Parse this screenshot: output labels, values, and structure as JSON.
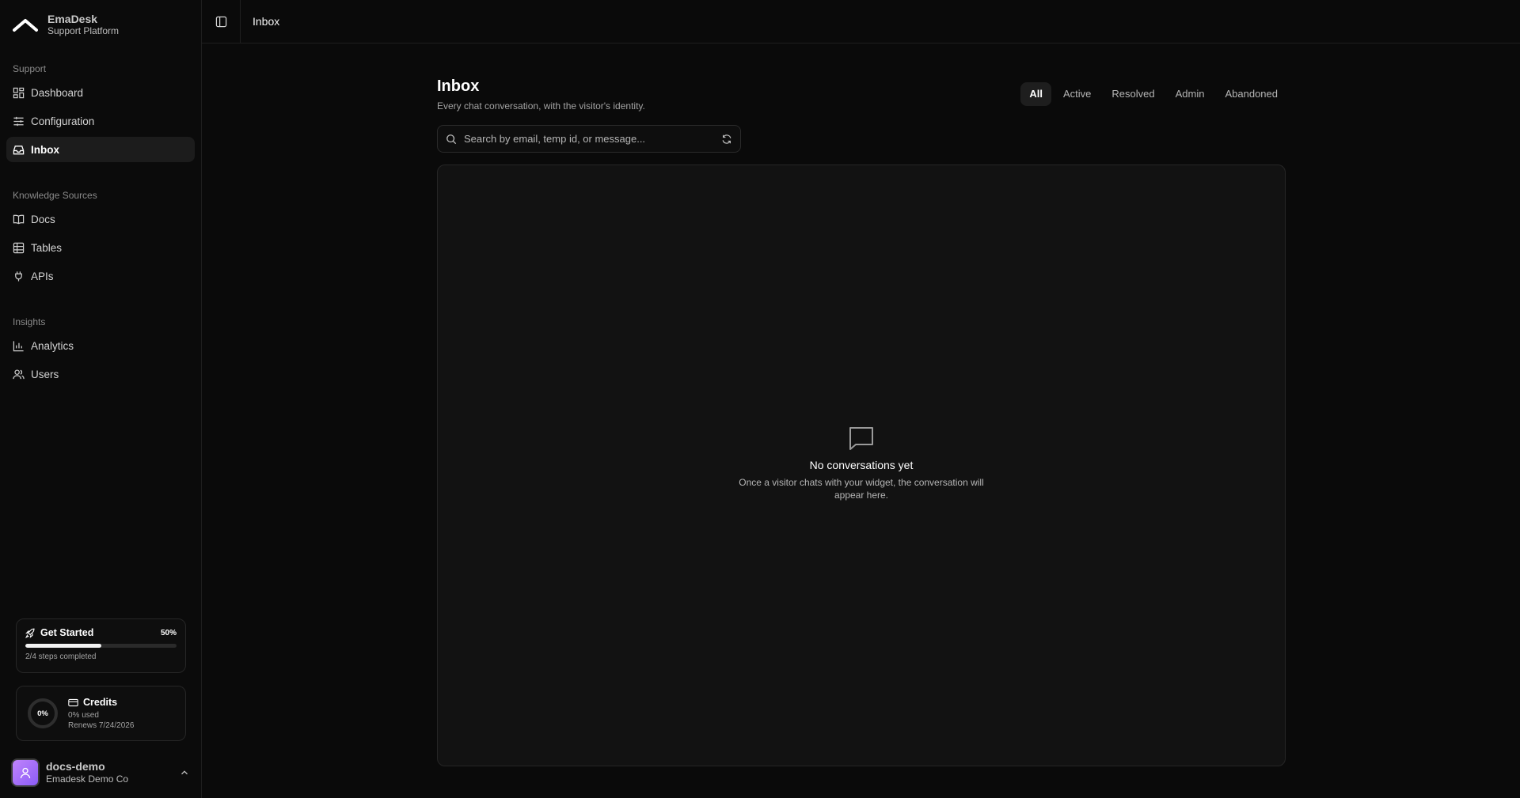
{
  "brand": {
    "name": "EmaDesk",
    "subtitle": "Support Platform"
  },
  "sidebar": {
    "groups": [
      {
        "label": "Support",
        "items": [
          {
            "label": "Dashboard",
            "icon": "dashboard-icon"
          },
          {
            "label": "Configuration",
            "icon": "sliders-icon"
          },
          {
            "label": "Inbox",
            "icon": "inbox-icon",
            "active": true
          }
        ]
      },
      {
        "label": "Knowledge Sources",
        "items": [
          {
            "label": "Docs",
            "icon": "book-icon"
          },
          {
            "label": "Tables",
            "icon": "table-icon"
          },
          {
            "label": "APIs",
            "icon": "plug-icon"
          }
        ]
      },
      {
        "label": "Insights",
        "items": [
          {
            "label": "Analytics",
            "icon": "bar-chart-icon"
          },
          {
            "label": "Users",
            "icon": "users-icon"
          }
        ]
      }
    ]
  },
  "get_started": {
    "title": "Get Started",
    "percent_label": "50%",
    "progress": 0.5,
    "steps": "2/4 steps completed"
  },
  "credits": {
    "title": "Credits",
    "ring_label": "0%",
    "used": "0% used",
    "renews": "Renews 7/24/2026"
  },
  "user": {
    "name": "docs-demo",
    "org": "Emadesk Demo Co"
  },
  "topbar": {
    "title": "Inbox"
  },
  "page": {
    "title": "Inbox",
    "subtitle": "Every chat conversation, with the visitor's identity.",
    "tabs": [
      {
        "label": "All",
        "active": true
      },
      {
        "label": "Active"
      },
      {
        "label": "Resolved"
      },
      {
        "label": "Admin"
      },
      {
        "label": "Abandoned"
      }
    ],
    "search_placeholder": "Search by email, temp id, or message...",
    "empty_title": "No conversations yet",
    "empty_text": "Once a visitor chats with your widget, the conversation will appear here."
  },
  "colors": {
    "background": "#0a0a0a",
    "panel": "#121212",
    "border": "#262626",
    "accent": "#ffffff",
    "avatar": "#a78bfa"
  }
}
